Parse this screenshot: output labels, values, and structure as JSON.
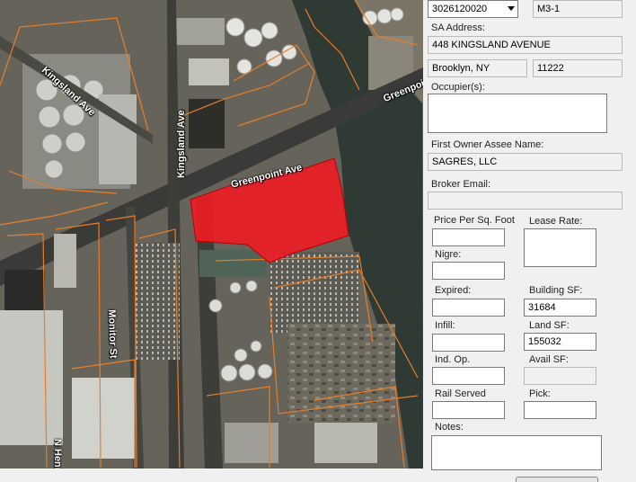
{
  "map": {
    "labels": {
      "kingsland_ave_1": "Kingsland Ave",
      "kingsland_ave_2": "Kingsland Ave",
      "greenpoint_ave_1": "Greenpoint Ave",
      "greenpoint_ave_2": "Greenpoint",
      "monitor_st": "Monitor St",
      "n_henry": "N Henr"
    },
    "parcel_color": "#ee1c24",
    "lot_line_color": "#e87e2a"
  },
  "form": {
    "bbl": "3026120020",
    "zoning": "M3-1",
    "sa_address_label": "SA Address:",
    "sa_address": "448 KINGSLAND AVENUE",
    "city": "Brooklyn, NY",
    "zip": "11222",
    "occupiers_label": "Occupier(s):",
    "occupiers": "",
    "first_owner_label": "First Owner Assee Name:",
    "first_owner": "SAGRES, LLC",
    "broker_email_label": "Broker Email:",
    "broker_email": "",
    "price_per_sqft_label": "Price Per Sq. Foot",
    "price_per_sqft": "",
    "lease_rate_label": "Lease Rate:",
    "lease_rate": "",
    "nigre_label": "Nigre:",
    "nigre": "",
    "expired_label": "Expired:",
    "expired": "",
    "building_sf_label": "Building SF:",
    "building_sf": "31684",
    "infill_label": "Infill:",
    "infill": "",
    "land_sf_label": "Land SF:",
    "land_sf": "155032",
    "ind_op_label": "Ind. Op.",
    "ind_op": "",
    "avail_sf_label": "Avail SF:",
    "avail_sf": "",
    "rail_served_label": "Rail Served",
    "rail_served": "",
    "pick_label": "Pick:",
    "pick": "",
    "notes_label": "Notes:",
    "notes": ""
  }
}
